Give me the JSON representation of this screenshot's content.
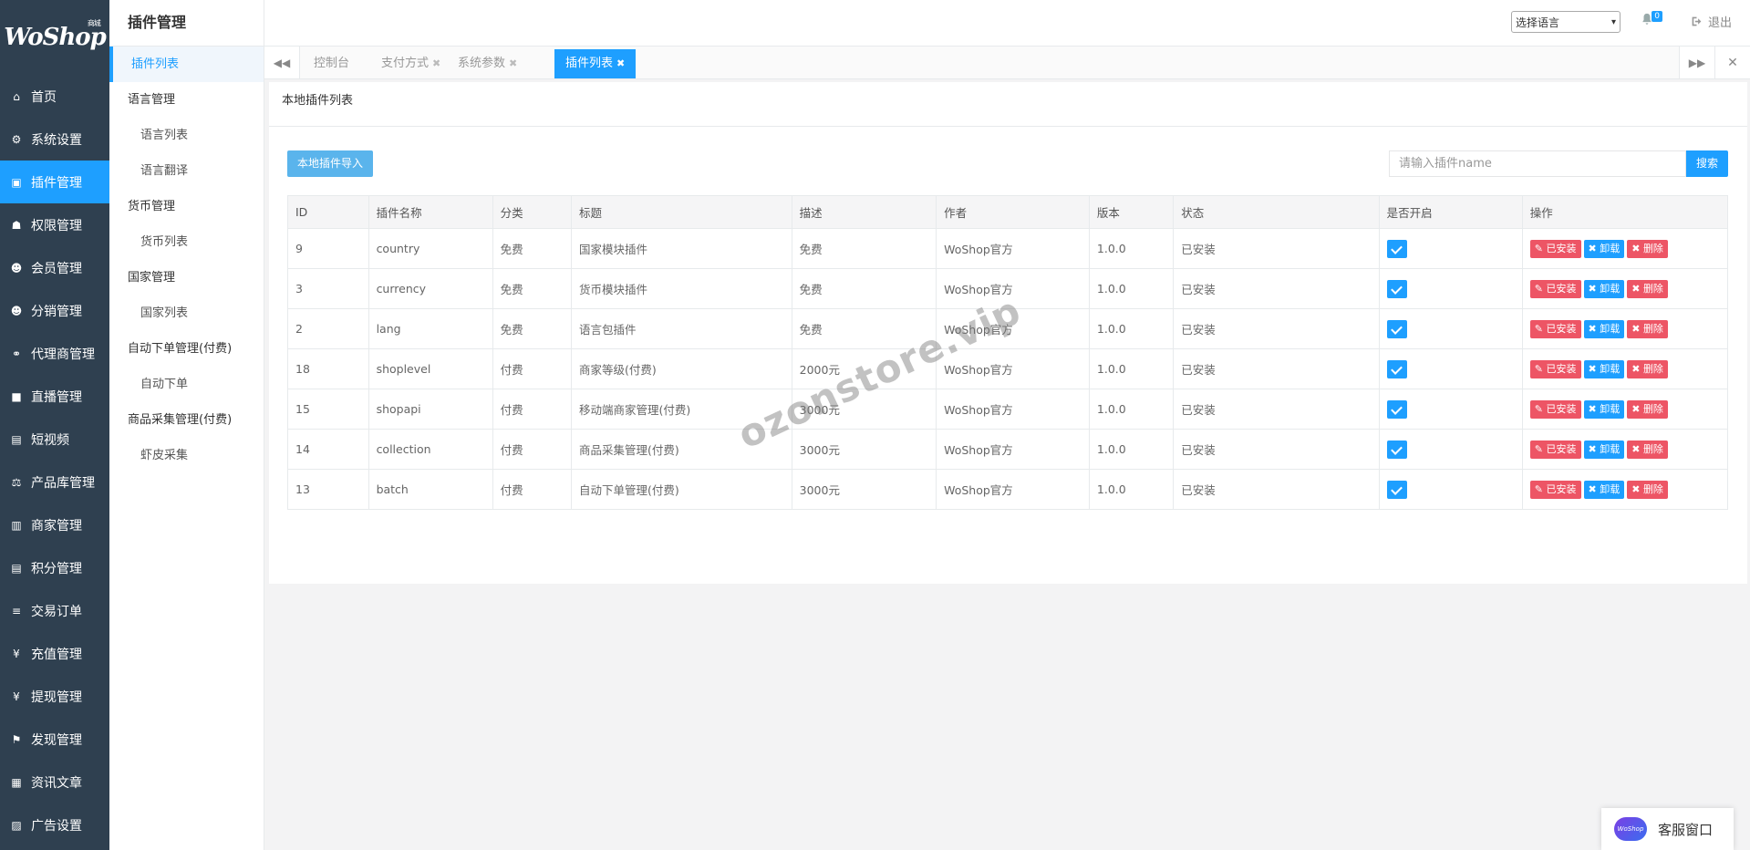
{
  "brand": {
    "logo_text": "WoShop",
    "logo_sup": "商城"
  },
  "sidebar": {
    "items": [
      {
        "label": "首页",
        "icon": "home-icon"
      },
      {
        "label": "系统设置",
        "icon": "gear-icon"
      },
      {
        "label": "插件管理",
        "icon": "plugin-icon"
      },
      {
        "label": "权限管理",
        "icon": "sitemap-icon"
      },
      {
        "label": "会员管理",
        "icon": "users-icon"
      },
      {
        "label": "分销管理",
        "icon": "users-icon"
      },
      {
        "label": "代理商管理",
        "icon": "link-icon"
      },
      {
        "label": "直播管理",
        "icon": "video-icon"
      },
      {
        "label": "短视频",
        "icon": "file-icon"
      },
      {
        "label": "产品库管理",
        "icon": "balance-icon"
      },
      {
        "label": "商家管理",
        "icon": "bank-icon"
      },
      {
        "label": "积分管理",
        "icon": "file-icon"
      },
      {
        "label": "交易订单",
        "icon": "order-icon"
      },
      {
        "label": "充值管理",
        "icon": "yen-icon"
      },
      {
        "label": "提现管理",
        "icon": "yen-icon"
      },
      {
        "label": "发现管理",
        "icon": "flag-icon"
      },
      {
        "label": "资讯文章",
        "icon": "newspaper-icon"
      },
      {
        "label": "广告设置",
        "icon": "image-icon"
      }
    ]
  },
  "submenu": {
    "title": "插件管理",
    "items": [
      {
        "label": "插件列表",
        "type": "active"
      },
      {
        "label": "语言管理",
        "type": "group"
      },
      {
        "label": "语言列表",
        "type": "child"
      },
      {
        "label": "语言翻译",
        "type": "child"
      },
      {
        "label": "货币管理",
        "type": "group"
      },
      {
        "label": "货币列表",
        "type": "child"
      },
      {
        "label": "国家管理",
        "type": "group"
      },
      {
        "label": "国家列表",
        "type": "child"
      },
      {
        "label": "自动下单管理(付费)",
        "type": "group"
      },
      {
        "label": "自动下单",
        "type": "child"
      },
      {
        "label": "商品采集管理(付费)",
        "type": "group"
      },
      {
        "label": "虾皮采集",
        "type": "child"
      }
    ]
  },
  "topbar": {
    "language_select": "选择语言",
    "notification_count": "0",
    "logout": "退出"
  },
  "tabs": [
    {
      "label": "控制台",
      "closable": false,
      "active": false
    },
    {
      "label": "支付方式",
      "closable": true,
      "active": false
    },
    {
      "label": "系统参数",
      "closable": true,
      "active": false
    },
    {
      "label": "插件列表",
      "closable": true,
      "active": true
    }
  ],
  "panel": {
    "title": "本地插件列表",
    "import_button": "本地插件导入",
    "search_placeholder": "请输入插件name",
    "search_button": "搜索"
  },
  "table": {
    "headers": [
      "ID",
      "插件名称",
      "分类",
      "标题",
      "描述",
      "作者",
      "版本",
      "状态",
      "是否开启",
      "操作"
    ],
    "rows": [
      [
        "9",
        "country",
        "免费",
        "国家模块插件",
        "免费",
        "WoShop官方",
        "1.0.0",
        "已安装"
      ],
      [
        "3",
        "currency",
        "免费",
        "货币模块插件",
        "免费",
        "WoShop官方",
        "1.0.0",
        "已安装"
      ],
      [
        "2",
        "lang",
        "免费",
        "语言包插件",
        "免费",
        "WoShop官方",
        "1.0.0",
        "已安装"
      ],
      [
        "18",
        "shoplevel",
        "付费",
        "商家等级(付费)",
        "2000元",
        "WoShop官方",
        "1.0.0",
        "已安装"
      ],
      [
        "15",
        "shopapi",
        "付费",
        "移动端商家管理(付费)",
        "3000元",
        "WoShop官方",
        "1.0.0",
        "已安装"
      ],
      [
        "14",
        "collection",
        "付费",
        "商品采集管理(付费)",
        "3000元",
        "WoShop官方",
        "1.0.0",
        "已安装"
      ],
      [
        "13",
        "batch",
        "付费",
        "自动下单管理(付费)",
        "3000元",
        "WoShop官方",
        "1.0.0",
        "已安装"
      ]
    ],
    "actions": {
      "installed": "已安装",
      "uninstall": "卸载",
      "delete": "删除"
    }
  },
  "watermark": "ozonstore.vip",
  "customer_service": {
    "label": "客服窗口",
    "logo": "WoShop"
  }
}
